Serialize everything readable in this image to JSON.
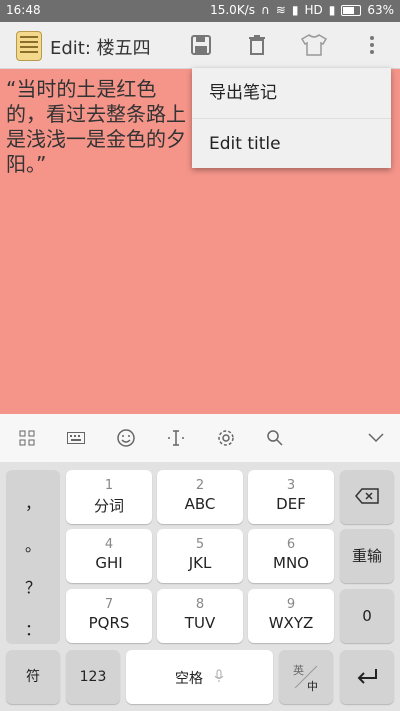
{
  "status": {
    "time": "16:48",
    "speed": "15.0K/s",
    "hd": "HD",
    "battery": "63%"
  },
  "toolbar": {
    "title": "Edit: 楼五四"
  },
  "editor": {
    "text": "“当时的土是红色的，看过去整条路上是浅浅一是金色的夕阳。”"
  },
  "menu": {
    "items": [
      "导出笔记",
      "Edit title"
    ]
  },
  "keyboard": {
    "punct": [
      "，",
      "。",
      "？",
      "："
    ],
    "keys": [
      {
        "num": "1",
        "lbl": "分词"
      },
      {
        "num": "2",
        "lbl": "ABC"
      },
      {
        "num": "3",
        "lbl": "DEF"
      },
      {
        "num": "4",
        "lbl": "GHI"
      },
      {
        "num": "5",
        "lbl": "JKL"
      },
      {
        "num": "6",
        "lbl": "MNO"
      },
      {
        "num": "7",
        "lbl": "PQRS"
      },
      {
        "num": "8",
        "lbl": "TUV"
      },
      {
        "num": "9",
        "lbl": "WXYZ"
      }
    ],
    "reenter": "重输",
    "zero": "0",
    "symbol": "符",
    "num123": "123",
    "space": "空格",
    "lang_top": "英",
    "lang_bottom": "中"
  }
}
